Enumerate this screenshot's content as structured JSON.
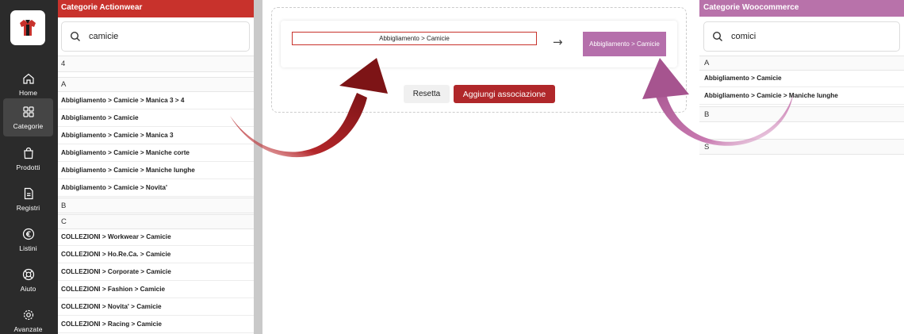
{
  "sidebar": {
    "logo": "t-shirt-logo",
    "items": [
      {
        "label": "Home",
        "icon": "home-icon"
      },
      {
        "label": "Categorie",
        "icon": "grid-icon",
        "active": true
      },
      {
        "label": "Prodotti",
        "icon": "bag-icon"
      },
      {
        "label": "Registri",
        "icon": "document-icon"
      },
      {
        "label": "Listini",
        "icon": "euro-icon"
      },
      {
        "label": "Aiuto",
        "icon": "lifebuoy-icon"
      },
      {
        "label": "Avanzate",
        "icon": "gear-icon"
      }
    ]
  },
  "left_panel": {
    "title": "Categorie Actionwear",
    "search_value": "camicie",
    "rows": [
      {
        "type": "letter",
        "text": "4"
      },
      {
        "type": "letter",
        "text": "A"
      },
      {
        "type": "item",
        "text": "Abbigliamento > Camicie > Manica 3 > 4"
      },
      {
        "type": "item",
        "text": "Abbigliamento > Camicie"
      },
      {
        "type": "item",
        "text": "Abbigliamento > Camicie > Manica 3"
      },
      {
        "type": "item",
        "text": "Abbigliamento > Camicie > Maniche corte"
      },
      {
        "type": "item",
        "text": "Abbigliamento > Camicie > Maniche lunghe"
      },
      {
        "type": "item",
        "text": "Abbigliamento > Camicie > Novita'"
      },
      {
        "type": "letter",
        "text": "B"
      },
      {
        "type": "letter",
        "text": "C"
      },
      {
        "type": "item",
        "text": "COLLEZIONI > Workwear > Camicie"
      },
      {
        "type": "item",
        "text": "COLLEZIONI > Ho.Re.Ca. > Camicie"
      },
      {
        "type": "item",
        "text": "COLLEZIONI > Corporate > Camicie"
      },
      {
        "type": "item",
        "text": "COLLEZIONI > Fashion > Camicie"
      },
      {
        "type": "item",
        "text": "COLLEZIONI > Novita' > Camicie"
      },
      {
        "type": "item",
        "text": "COLLEZIONI > Racing > Camicie"
      }
    ]
  },
  "association": {
    "source": "Abbigliamento > Camicie",
    "arrow": "→",
    "target": "Abbigliamento > Camicie",
    "reset_label": "Resetta",
    "add_label": "Aggiungi associazione"
  },
  "right_panel": {
    "title": "Categorie Woocommerce",
    "search_value": "comici",
    "rows": [
      {
        "type": "letter",
        "text": "A"
      },
      {
        "type": "item",
        "text": "Abbigliamento > Camicie"
      },
      {
        "type": "item",
        "text": "Abbigliamento > Camicie > Maniche lunghe"
      },
      {
        "type": "letter",
        "text": "B"
      },
      {
        "type": "letter",
        "text": "S"
      }
    ]
  },
  "colors": {
    "sidebar": "#2b2b2b",
    "actionwear_accent": "#c8322c",
    "woocommerce_accent": "#b872aa",
    "add_button": "#b0272a"
  }
}
